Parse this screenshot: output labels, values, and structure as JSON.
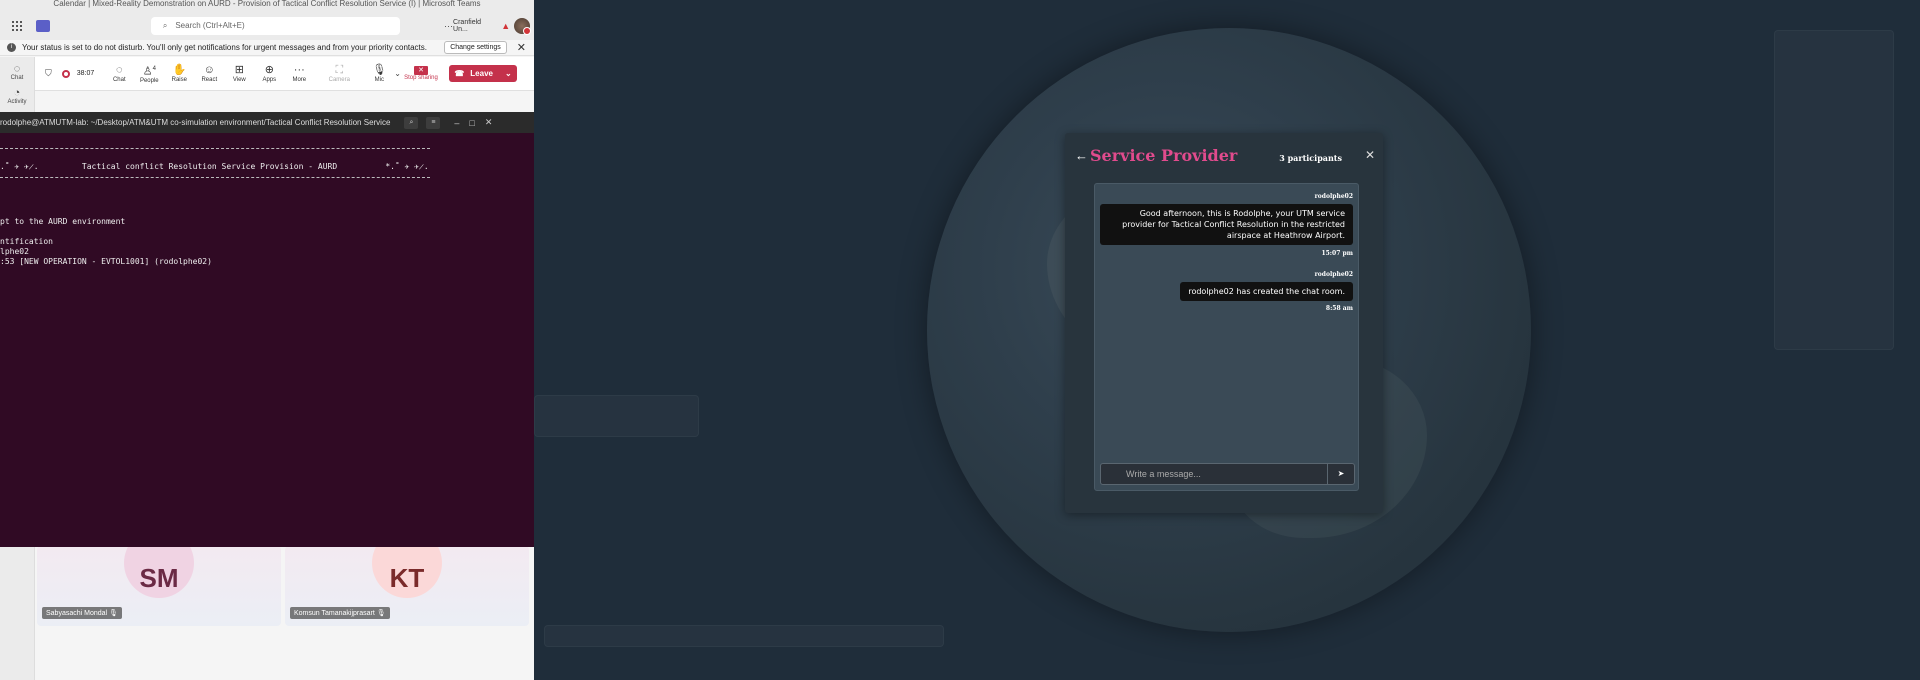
{
  "teams": {
    "window_title": "Calendar | Mixed-Reality Demonstration on AURD - Provision of Tactical Conflict Resolution Service (I) | Microsoft Teams",
    "search_placeholder": "Search (Ctrl+Alt+E)",
    "org_name": "Cranfield Un...",
    "dnd_message": "Your status is set to do not disturb. You'll only get notifications for urgent messages and from your priority contacts.",
    "change_settings": "Change settings",
    "rail": [
      {
        "label": "Chat"
      },
      {
        "label": "Activity"
      }
    ],
    "call": {
      "timer": "38:07",
      "people_count": "4",
      "buttons": [
        {
          "label": "Chat",
          "icon": "chat-icon"
        },
        {
          "label": "People",
          "icon": "people-icon"
        },
        {
          "label": "Raise",
          "icon": "raise-hand-icon"
        },
        {
          "label": "React",
          "icon": "react-icon"
        },
        {
          "label": "View",
          "icon": "view-icon"
        },
        {
          "label": "Apps",
          "icon": "apps-icon"
        },
        {
          "label": "More",
          "icon": "more-icon"
        },
        {
          "label": "Camera",
          "icon": "camera-icon"
        },
        {
          "label": "Mic",
          "icon": "mic-icon"
        }
      ],
      "stop_sharing": "Stop sharing",
      "leave": "Leave"
    },
    "tiles": [
      {
        "initials": "SM",
        "name": "Sabyasachi Mondal"
      },
      {
        "initials": "KT",
        "name": "Komsun Tamanakijprasart"
      }
    ]
  },
  "terminal": {
    "title": "rodolphe@ATMUTM-lab: ~/Desktop/ATM&UTM co-simulation environment/Tactical Conflict Resolution Service",
    "lines": [
      ".˚ ✈ ✈̷.         Tactical conflict Resolution Service Provision - AURD          *.˚ ✈ ✈̷.",
      "pt to the AURD environment",
      "ntification",
      "lphe02",
      ":53 [NEW OPERATION - EVTOL1001] (rodolphe02)"
    ]
  },
  "chat": {
    "title": "Service Provider",
    "participants": "3 participants",
    "messages": [
      {
        "sender": "rodolphe02",
        "text": "Good afternoon, this is Rodolphe, your UTM service provider for Tactical Conflict Resolution in the restricted airspace at Heathrow Airport.",
        "time": "15:07 pm"
      },
      {
        "sender": "rodolphe02",
        "text": "rodolphe02 has created the chat room.",
        "time": "8:58 am"
      }
    ],
    "input_placeholder": "Write a message..."
  },
  "colors": {
    "chat_title": "#e14b8d",
    "terminal_bg": "#300a24",
    "leave_red": "#c4314b",
    "background": "#1f2d3a"
  }
}
